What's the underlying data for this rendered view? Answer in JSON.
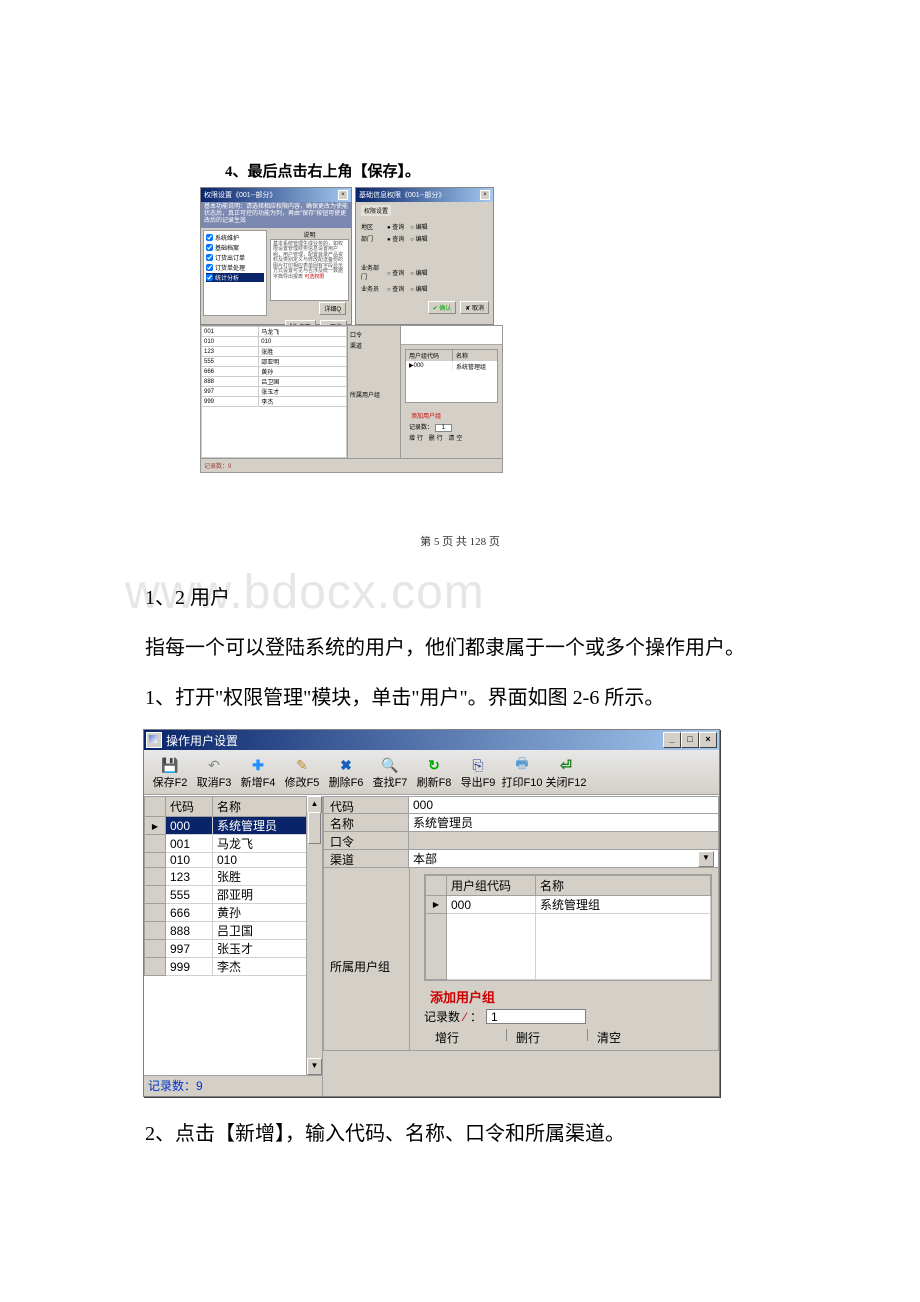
{
  "doc": {
    "caption_top": "4、最后点击右上角【保存】。",
    "page_footer": "第 5 页 共 128 页",
    "watermark": "www.bdocx.com",
    "section_title": "1、2 用户",
    "para1": "指每一个可以登陆系统的用户，他们都隶属于一个或多个操作用户。",
    "para2": "1、打开\"权限管理\"模块，单击\"用户\"。界面如图 2-6 所示。",
    "para3": "2、点击【新增】，输入代码、名称、口令和所属渠道。"
  },
  "top_shot": {
    "win_a": {
      "title": "权限设置《001--部分》",
      "intro": "基本功能说明：请选择相应权限内容，确保更改为使能状态后，真正可控的功能为列，再由\"保存\"按钮可使更改后的记录生效",
      "checks": [
        "系统维护",
        "基础档案",
        "订货出订单",
        "订货单处理",
        "统计分析"
      ],
      "desc_label": "说明",
      "desc": "基本系统管理生成业务的，如权限设置管理财务信息设置用户组，用户管理，配置目录产品资料及类别定义与修改配送备份的图片打印相应表单固有字段显示方式设置可见与否涉及统一数据字典导出报表",
      "desc_red": "可选权限",
      "detail_btn": "详细Q",
      "save_btn": "保存",
      "cancel_btn": "× 取消"
    },
    "win_b": {
      "title": "基础信息权限《001--部分》",
      "group": "权限设置",
      "rows": [
        {
          "k": "地区",
          "on": "● 查询",
          "off": "○ 编辑"
        },
        {
          "k": "部门",
          "on": "● 查询",
          "off": "○ 编辑"
        }
      ],
      "rows2": [
        {
          "k": "业务部门",
          "off1": "○ 查询",
          "off2": "○ 编辑"
        },
        {
          "k": "业务员",
          "off1": "○ 查询",
          "off2": "○ 编辑"
        }
      ],
      "ok_btn": "✔ 确认",
      "cancel_btn": "✘ 取消"
    },
    "lower_left": [
      {
        "c": "001",
        "n": "马龙飞"
      },
      {
        "c": "010",
        "n": "010"
      },
      {
        "c": "123",
        "n": "张胜"
      },
      {
        "c": "555",
        "n": "邵亚明"
      },
      {
        "c": "666",
        "n": "黄孙"
      },
      {
        "c": "888",
        "n": "吕卫国"
      },
      {
        "c": "997",
        "n": "张玉才"
      },
      {
        "c": "999",
        "n": "李杰"
      }
    ],
    "mid": {
      "l1": "口令",
      "l2": "渠道",
      "l3": "所属用户组"
    },
    "right": {
      "h1": "用户组代码",
      "h2": "名称",
      "r1c1": "000",
      "r1c2": "系统管理组",
      "add": "添加用户组",
      "rec": "记录数：",
      "rec_v": "1",
      "btns": "增行   删行   清空"
    },
    "footer": "记录数：9"
  },
  "user_win": {
    "title": "操作用户设置",
    "sysbtns": {
      "min": "_",
      "max": "□",
      "close": "×"
    },
    "toolbar": [
      {
        "icon": "💾",
        "cls": "ticon-save",
        "label": "保存F2",
        "name": "tb-save"
      },
      {
        "icon": "↶",
        "cls": "ticon-undo",
        "label": "取消F3",
        "name": "tb-cancel"
      },
      {
        "icon": "✚",
        "cls": "ticon-plus",
        "label": "新增F4",
        "name": "tb-new"
      },
      {
        "icon": "✎",
        "cls": "ticon-edit",
        "label": "修改F5",
        "name": "tb-edit"
      },
      {
        "icon": "✖",
        "cls": "ticon-del",
        "label": "删除F6",
        "name": "tb-delete"
      },
      {
        "icon": "🔍",
        "cls": "ticon-find",
        "label": "查找F7",
        "name": "tb-find"
      },
      {
        "icon": "↻",
        "cls": "ticon-ref",
        "label": "刷新F8",
        "name": "tb-refresh"
      },
      {
        "icon": "⎘",
        "cls": "ticon-exp",
        "label": "导出F9",
        "name": "tb-export"
      },
      {
        "icon": "🖶",
        "cls": "ticon-prn",
        "label": "打印F10",
        "name": "tb-print"
      },
      {
        "icon": "⏎",
        "cls": "ticon-close",
        "label": "关闭F12",
        "name": "tb-close"
      }
    ],
    "grid_headers": {
      "code": "代码",
      "name": "名称"
    },
    "rows": [
      {
        "code": "000",
        "name": "系统管理员",
        "sel": true
      },
      {
        "code": "001",
        "name": "马龙飞"
      },
      {
        "code": "010",
        "name": "010"
      },
      {
        "code": "123",
        "name": "张胜"
      },
      {
        "code": "555",
        "name": "邵亚明"
      },
      {
        "code": "666",
        "name": "黄孙"
      },
      {
        "code": "888",
        "name": "吕卫国"
      },
      {
        "code": "997",
        "name": "张玉才"
      },
      {
        "code": "999",
        "name": "李杰"
      }
    ],
    "left_footer": "记录数：9",
    "form": {
      "code_lbl": "代码",
      "code": "000",
      "name_lbl": "名称",
      "name": "系统管理员",
      "pwd_lbl": "口令",
      "pwd": "",
      "chan_lbl": "渠道",
      "chan": "本部",
      "grp_lbl": "所属用户组"
    },
    "ug_headers": {
      "code": "用户组代码",
      "name": "名称"
    },
    "ug_row": {
      "code": "000",
      "name": "系统管理组"
    },
    "add_group": "添加用户组",
    "rec_label": "记录数",
    "rec_val": "1",
    "rowbtns": {
      "add": "增行",
      "del": "删行",
      "clr": "清空"
    }
  }
}
